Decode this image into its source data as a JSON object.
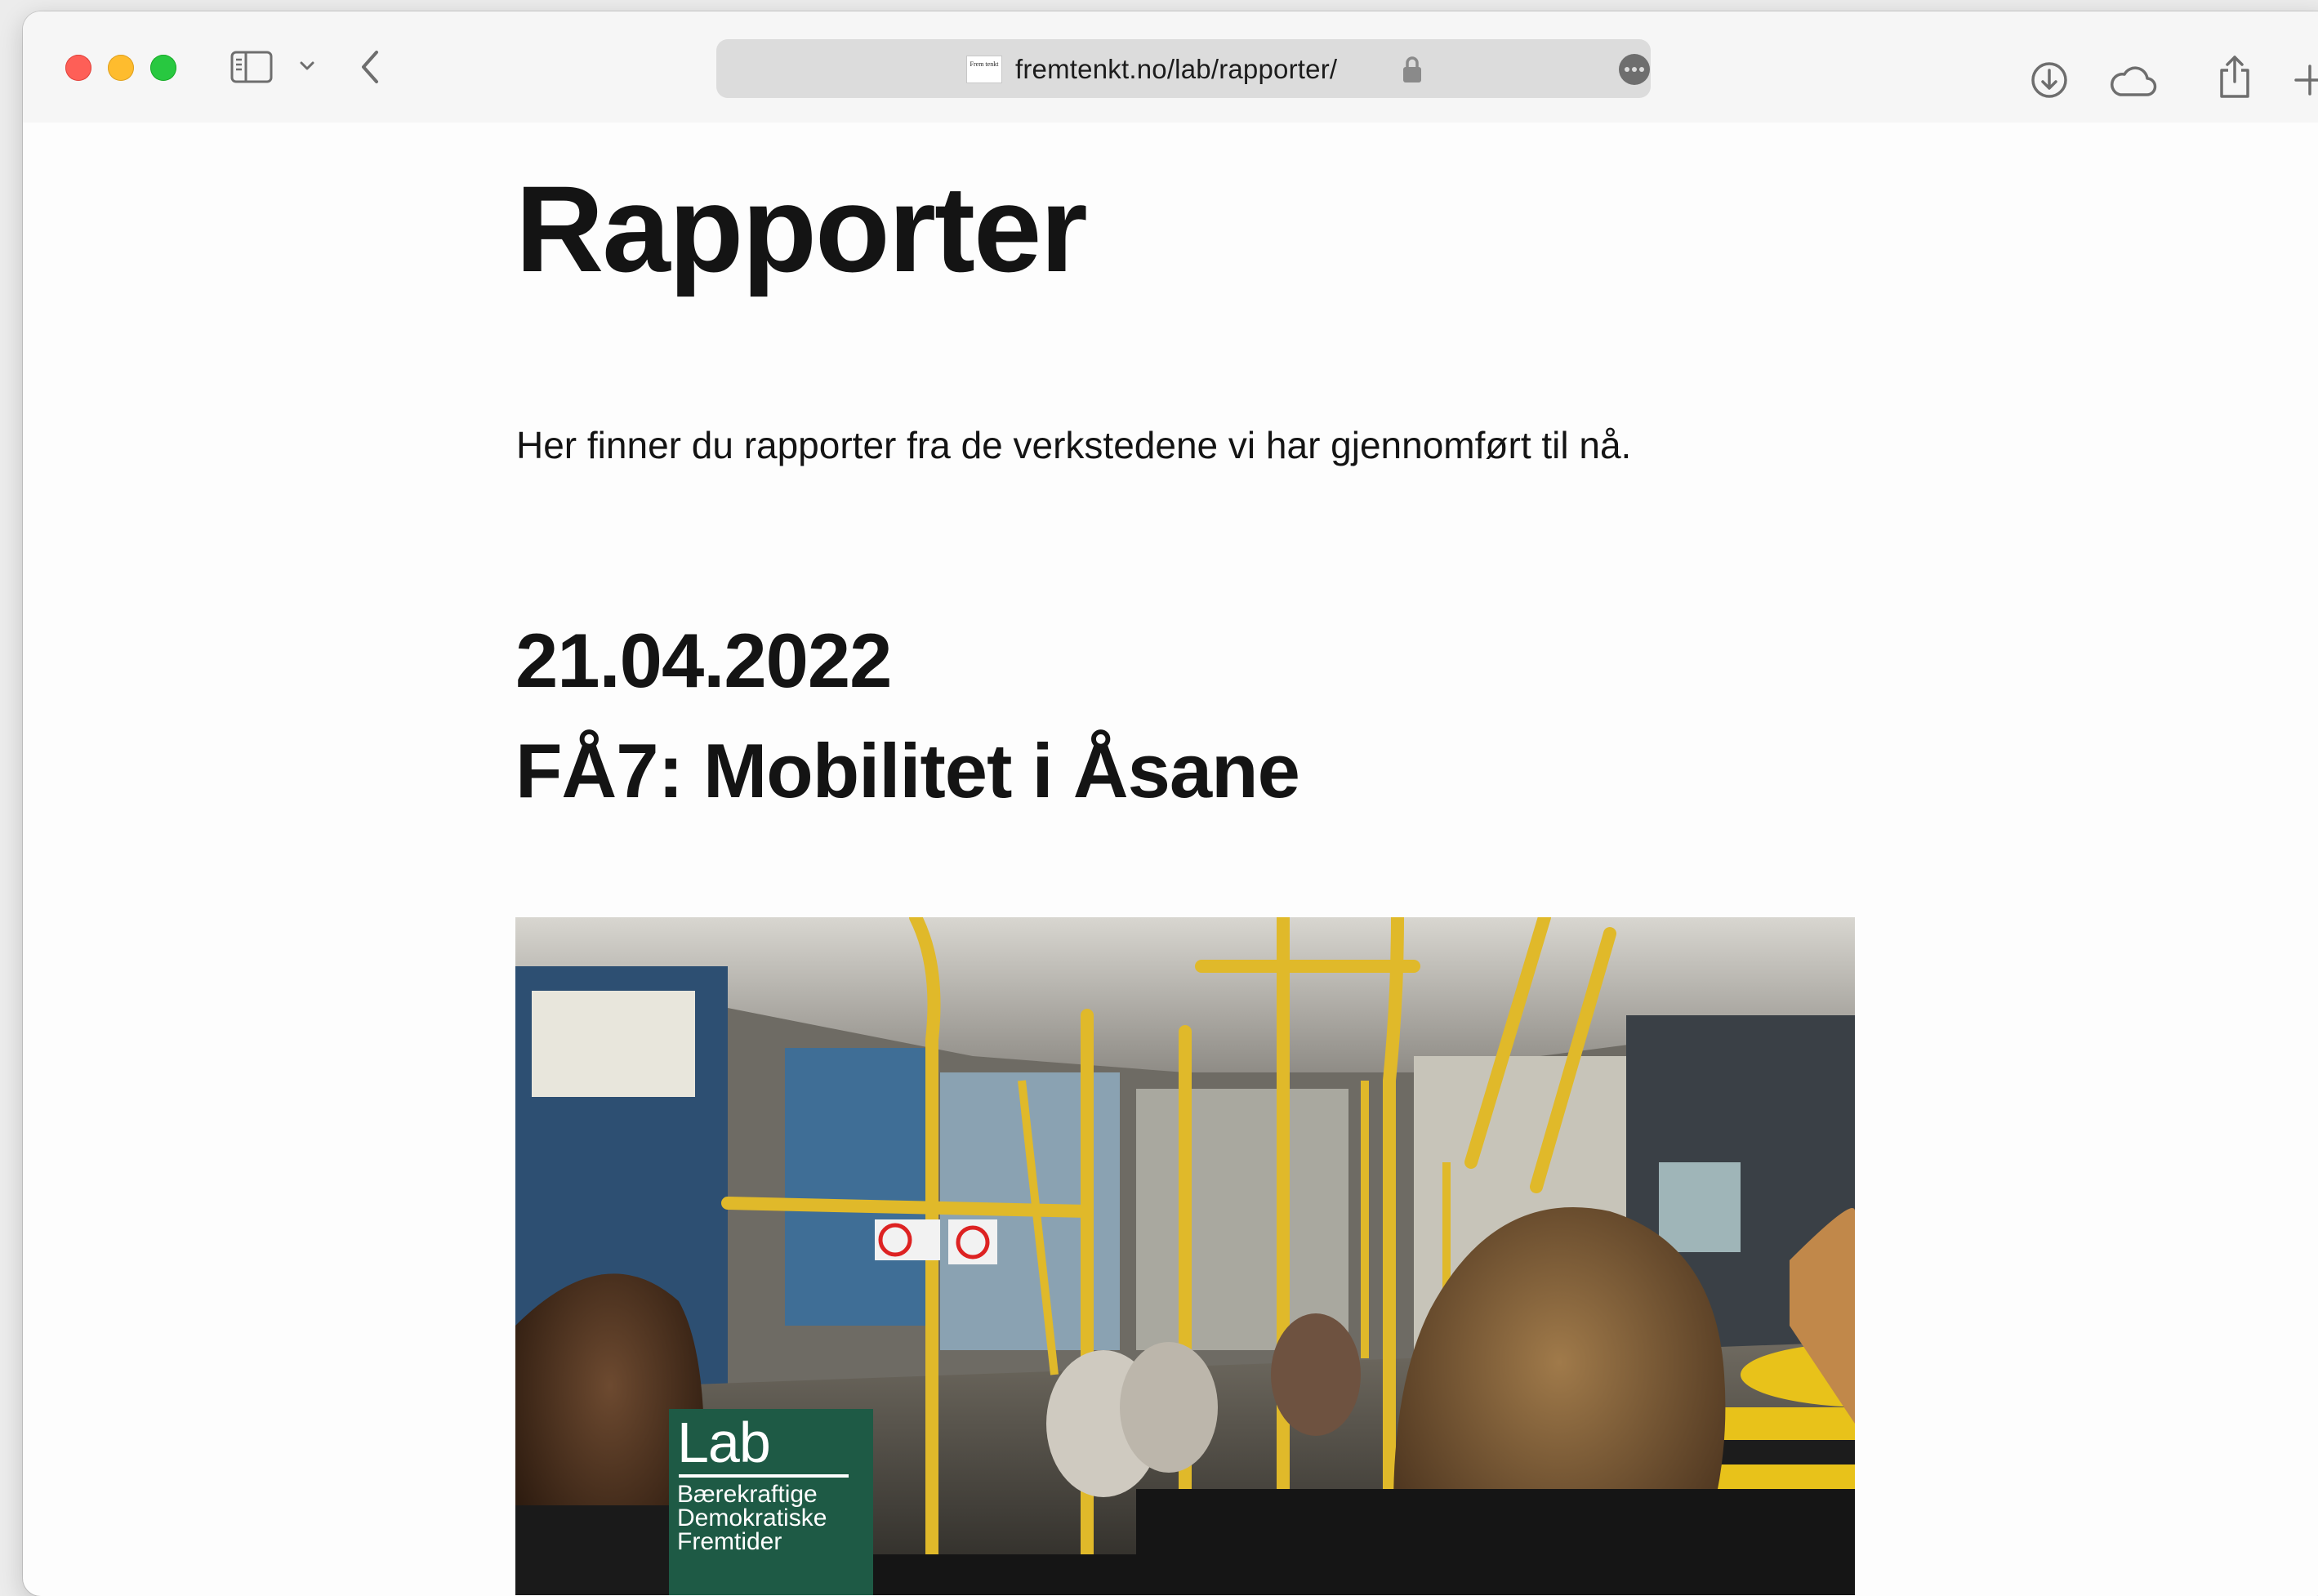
{
  "browser": {
    "url": "fremtenkt.no/lab/rapporter/",
    "favicon_text": "Frem tenkt",
    "toolbar_icons": [
      "sidebar-icon",
      "chevron-down-icon",
      "back-icon",
      "lock-icon",
      "more-icon",
      "download-icon",
      "cloud-icon",
      "share-icon",
      "new-tab-icon"
    ]
  },
  "page": {
    "title": "Rapporter",
    "intro": "Her finner du rapporter fra de verkstedene vi har gjennomført til nå.",
    "report": {
      "date": "21.04.2022",
      "title": "FÅ7: Mobilitet i Åsane",
      "image_logo": {
        "word": "Lab",
        "lines": [
          "Bærekraftige",
          "Demokratiske",
          "Fremtider"
        ],
        "color": "#1e5a45"
      }
    }
  }
}
